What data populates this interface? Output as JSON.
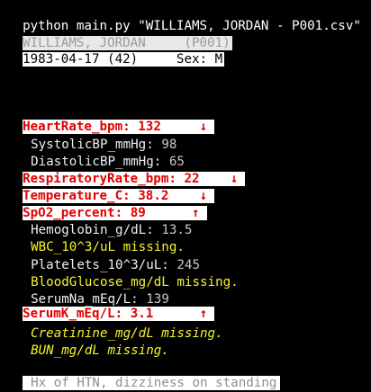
{
  "terminal": {
    "command": "python main.py \"WILLIAMS, JORDAN - P001.csv\"",
    "header_line1": "WILLIAMS, JORDAN     (P001)",
    "header_line2": "1983-04-17 (42)     Sex: M"
  },
  "vitals": [
    {
      "label": "HeartRate_bpm:",
      "value": "132",
      "arrow": "↓",
      "status": "abnormal"
    },
    {
      "label": "SystolicBP_mmHg:",
      "value": "98",
      "status": "normal"
    },
    {
      "label": "DiastolicBP_mmHg:",
      "value": "65",
      "status": "normal"
    },
    {
      "label": "RespiratoryRate_bpm:",
      "value": "22",
      "arrow": "↓",
      "status": "abnormal"
    },
    {
      "label": "Temperature_C:",
      "value": "38.2",
      "arrow": "↓",
      "status": "abnormal"
    },
    {
      "label": "SpO2_percent:",
      "value": "89",
      "arrow": "↑",
      "status": "abnormal"
    },
    {
      "label": "Hemoglobin_g/dL:",
      "value": "13.5",
      "status": "normal"
    },
    {
      "label": "WBC_10^3/uL missing.",
      "status": "missing"
    },
    {
      "label": "Platelets_10^3/uL:",
      "value": "245",
      "status": "normal"
    },
    {
      "label": "BloodGlucose_mg/dL missing.",
      "status": "missing"
    },
    {
      "label": "SerumNa_mEq/L:",
      "value": "139",
      "status": "normal"
    },
    {
      "label": "SerumK_mEq/L:",
      "value": "3.1",
      "arrow": "↑",
      "status": "abnormal"
    },
    {
      "label": "Creatinine_mg/dL missing.",
      "status": "missing-italic"
    },
    {
      "label": "BUN_mg/dL missing.",
      "status": "missing-italic"
    }
  ],
  "note": "Hx of HTN, dizziness on standing",
  "colors": {
    "background": "#000000",
    "abnormal_text": "#e00000",
    "missing_text": "#f4f42a",
    "normal_text": "#f0f0f0"
  }
}
